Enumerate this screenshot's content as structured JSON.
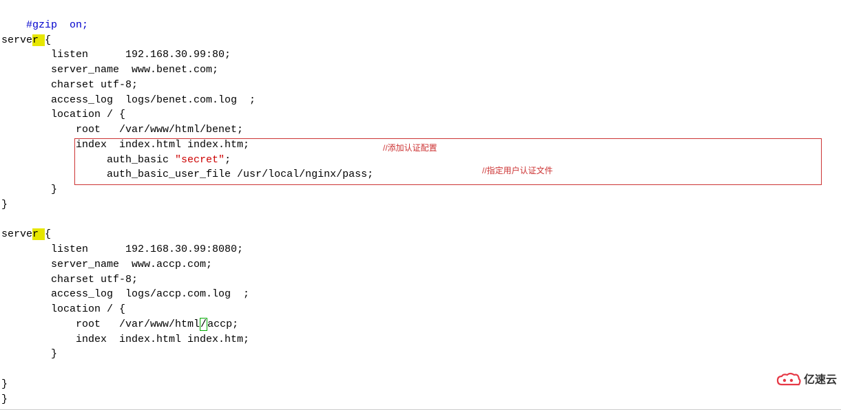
{
  "code": {
    "line1": "    #gzip  on;",
    "line2a": "serve",
    "line2b": "r ",
    "line2c": "{",
    "line3": "        listen      192.168.30.99:80;",
    "line4": "        server_name  www.benet.com;",
    "line5": "        charset utf-8;",
    "line6": "        access_log  logs/benet.com.log  ;",
    "line7": "        location / {",
    "line8": "            root   /var/www/html/benet;",
    "line9": "            index  index.html index.htm;",
    "line10a": "                 auth_basic ",
    "line10b": "\"secret\"",
    "line10c": ";",
    "line11": "                 auth_basic_user_file /usr/local/nginx/pass;",
    "line12": "        }",
    "line13": "}",
    "line14": "",
    "line15a": "serve",
    "line15b": "r ",
    "line15c": "{",
    "line16": "        listen      192.168.30.99:8080;",
    "line17": "        server_name  www.accp.com;",
    "line18": "        charset utf-8;",
    "line19": "        access_log  logs/accp.com.log  ;",
    "line20": "        location / {",
    "line21a": "            root   /var/www/html",
    "line21b": "/",
    "line21c": "accp;",
    "line22": "            index  index.html index.htm;",
    "line23": "        }",
    "line24": "",
    "line25": "}",
    "line26": "}"
  },
  "annotations": {
    "comment1": "//添加认证配置",
    "comment2": "//指定用户认证文件"
  },
  "logo": {
    "text": "亿速云"
  }
}
